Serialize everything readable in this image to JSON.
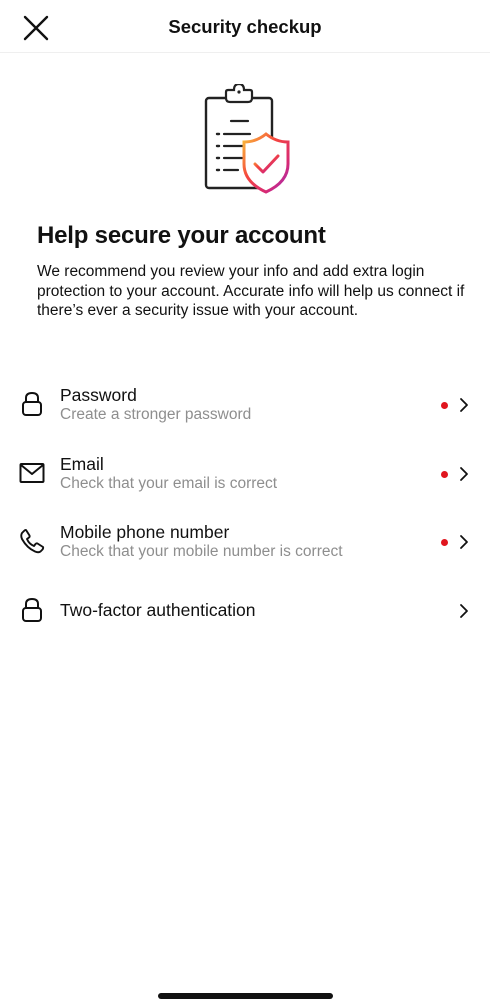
{
  "header": {
    "title": "Security checkup",
    "close_icon": "close-icon"
  },
  "illustration": {
    "icon": "clipboard-shield-check-illustration",
    "gradient_colors": [
      "#f9c43a",
      "#f5453d",
      "#d62976",
      "#962fbf"
    ]
  },
  "main": {
    "heading": "Help secure your account",
    "description": "We recommend you review your info and add extra login protection to your account. Accurate info will help us connect if there’s ever a security issue with your account."
  },
  "items": [
    {
      "icon": "lock-icon",
      "title": "Password",
      "subtitle": "Create a stronger password",
      "has_alert_dot": true
    },
    {
      "icon": "envelope-icon",
      "title": "Email",
      "subtitle": "Check that your email is correct",
      "has_alert_dot": true
    },
    {
      "icon": "phone-icon",
      "title": "Mobile phone number",
      "subtitle": "Check that your mobile number is correct",
      "has_alert_dot": true
    },
    {
      "icon": "lock-icon",
      "title": "Two-factor authentication",
      "subtitle": "",
      "has_alert_dot": false
    }
  ],
  "colors": {
    "alert_dot": "#e0161e",
    "subtitle_text": "#8e8e8e",
    "primary_text": "#111111"
  }
}
